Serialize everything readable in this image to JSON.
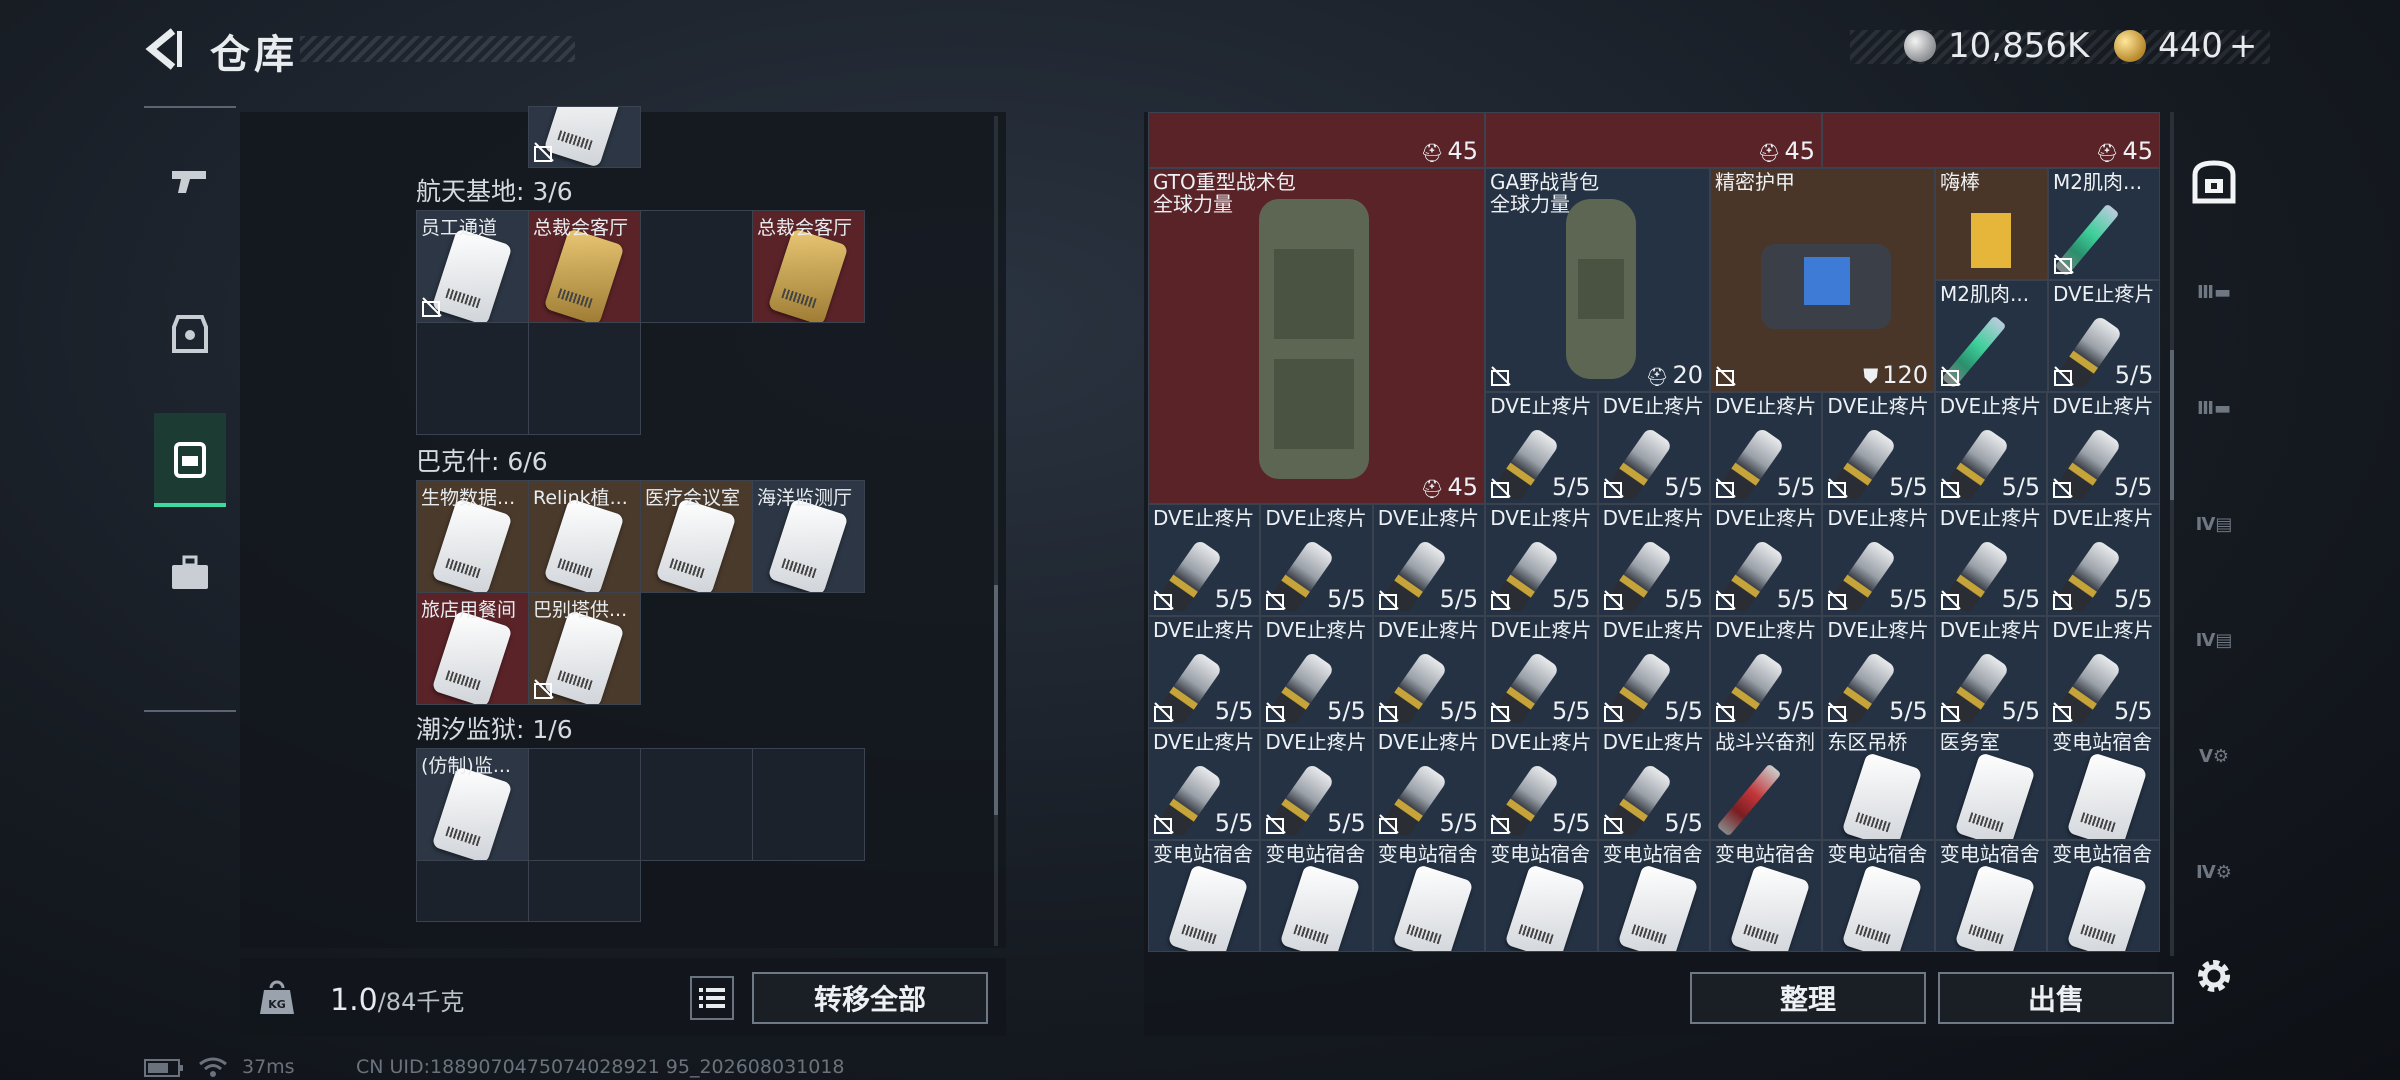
{
  "header": {
    "title": "仓库",
    "silver": "10,856K",
    "gold": "440",
    "gold_add": "+"
  },
  "left_panel": {
    "sections": [
      {
        "label": "航天基地: 3/6",
        "cells": [
          {
            "name": "员工通道",
            "color": "blue",
            "card": "white",
            "nolock": true
          },
          {
            "name": "总裁会客厅",
            "color": "red",
            "card": "gold",
            "nolock": false
          },
          {
            "name": "",
            "color": "empty",
            "card": "",
            "nolock": false
          },
          {
            "name": "总裁会客厅",
            "color": "red",
            "card": "gold",
            "nolock": false
          }
        ]
      },
      {
        "label": "巴克什: 6/6",
        "cells": [
          {
            "name": "生物数据...",
            "color": "brown"
          },
          {
            "name": "Relink植...",
            "color": "brown"
          },
          {
            "name": "医疗会议室",
            "color": "brown"
          },
          {
            "name": "海洋监测厅",
            "color": "blue"
          },
          {
            "name": "旅店用餐间",
            "color": "red"
          },
          {
            "name": "巴别塔供...",
            "color": "brown"
          }
        ]
      },
      {
        "label": "潮汐监狱: 1/6",
        "cells": [
          {
            "name": "(仿制)监...",
            "color": "blue"
          }
        ]
      }
    ],
    "weight_value": "1.0",
    "weight_max": "/84千克",
    "transfer_all": "转移全部"
  },
  "right_panel": {
    "top_counts": [
      "45",
      "45",
      "45"
    ],
    "big_items": [
      {
        "name": "GTO重型战术包\n全球力量",
        "count": "45"
      },
      {
        "name": "GA野战背包\n全球力量",
        "count": "20"
      },
      {
        "name": "精密护甲",
        "count": "120"
      }
    ],
    "small_items": {
      "haibang": "嗨棒",
      "m2": "M2肌肉...",
      "dve": "DVE止疼片",
      "dve_count": "5/5",
      "combat": "战斗兴奋剂",
      "east_bridge": "东区吊桥",
      "clinic": "医务室",
      "substation": "变电站宿舍"
    },
    "organize": "整理",
    "sell": "出售"
  },
  "status_bar": {
    "ping": "37ms",
    "uid": "CN UID:1889070475074028921 95_202608031018"
  }
}
